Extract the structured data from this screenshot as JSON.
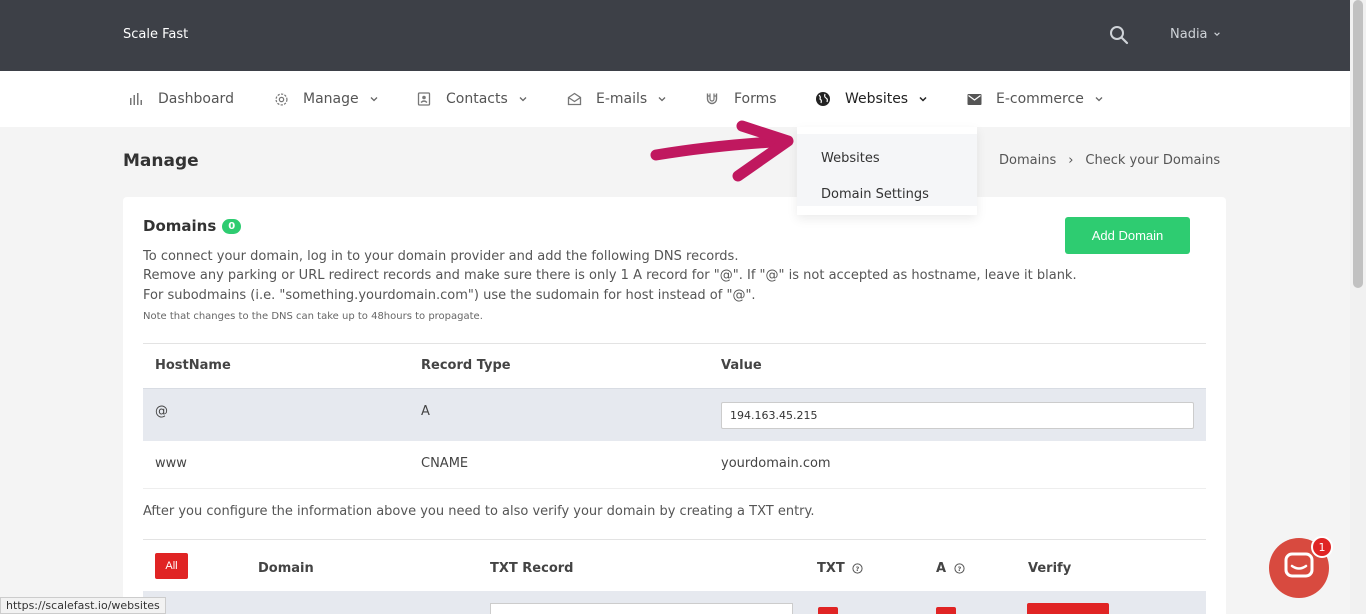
{
  "header": {
    "brand": "Scale Fast",
    "user": "Nadia"
  },
  "nav": {
    "items": [
      {
        "label": "Dashboard",
        "icon": "bar-chart-icon"
      },
      {
        "label": "Manage",
        "icon": "gear-icon"
      },
      {
        "label": "Contacts",
        "icon": "contact-card-icon"
      },
      {
        "label": "E-mails",
        "icon": "envelope-open-icon"
      },
      {
        "label": "Forms",
        "icon": "magnet-icon"
      },
      {
        "label": "Websites",
        "icon": "globe-icon"
      },
      {
        "label": "E-commerce",
        "icon": "envelope-icon"
      }
    ]
  },
  "dropdown": {
    "items": [
      "Websites",
      "Domain Settings"
    ]
  },
  "page": {
    "title": "Manage",
    "breadcrumb": [
      "Domains",
      "Check your Domains"
    ]
  },
  "card": {
    "title": "Domains",
    "count": "0",
    "add_button": "Add Domain",
    "desc1": "To connect your domain, log in to your domain provider and add the following DNS records.",
    "desc2": "Remove any parking or URL redirect records and make sure there is only 1 A record for \"@\". If \"@\" is not accepted as hostname, leave it blank.",
    "desc3": "For subodmains (i.e. \"something.yourdomain.com\") use the sudomain for host instead of \"@\".",
    "note": "Note that changes to the DNS can take up to 48hours to propagate."
  },
  "dns_table": {
    "headers": [
      "HostName",
      "Record Type",
      "Value"
    ],
    "rows": [
      {
        "host": "@",
        "type": "A",
        "value": "194.163.45.215"
      },
      {
        "host": "www",
        "type": "CNAME",
        "value": "yourdomain.com"
      }
    ]
  },
  "verify_text": "After you configure the information above you need to also verify your domain by creating a TXT entry.",
  "txt_table": {
    "all_button": "All",
    "headers": [
      "Domain",
      "TXT Record",
      "TXT",
      "A",
      "Verify"
    ]
  },
  "status_url": "https://scalefast.io/websites",
  "chat": {
    "badge": "1"
  },
  "colors": {
    "topbar": "#3d4047",
    "green": "#2ecc71",
    "red": "#e02424",
    "arrow": "#c0185f",
    "chat": "#d84a3f"
  }
}
